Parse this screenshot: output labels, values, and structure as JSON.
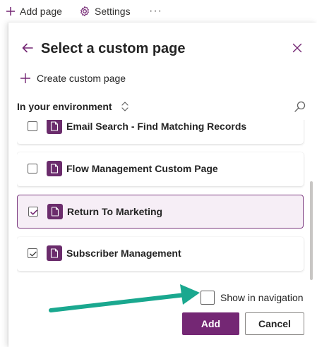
{
  "command_bar": {
    "add_page_label": "Add page",
    "settings_label": "Settings",
    "more_label": "···"
  },
  "panel": {
    "title": "Select a custom page",
    "create_label": "Create custom page",
    "filter_label": "In your environment",
    "items": [
      {
        "label": "Email Search - Find Matching Records",
        "checked": false,
        "selected": false
      },
      {
        "label": "Flow Management Custom Page",
        "checked": false,
        "selected": false
      },
      {
        "label": "Return To Marketing",
        "checked": true,
        "selected": true
      },
      {
        "label": "Subscriber Management",
        "checked": true,
        "selected": false
      }
    ],
    "show_in_navigation_label": "Show in navigation",
    "show_in_navigation_checked": false,
    "add_label": "Add",
    "cancel_label": "Cancel"
  },
  "colors": {
    "accent": "#742774",
    "page_icon": "#6b2c6c",
    "selected_bg": "#f6eef6",
    "annotation_arrow": "#1aa88f"
  },
  "icons": {
    "add": "plus-icon",
    "settings": "gear-icon",
    "back": "arrow-left-icon",
    "close": "close-icon",
    "sort": "chevron-up-down-icon",
    "search": "search-icon",
    "page": "page-icon",
    "check": "checkmark-icon"
  }
}
